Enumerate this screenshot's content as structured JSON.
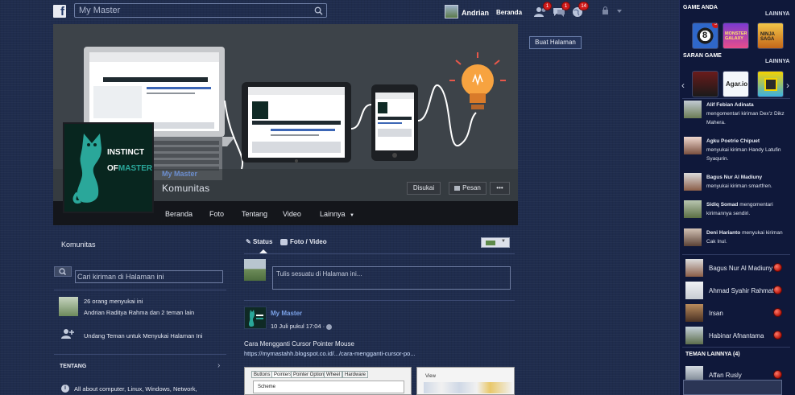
{
  "topbar": {
    "logo": "f",
    "search_placeholder": "My Master",
    "user_name": "Andrian",
    "home_label": "Beranda",
    "friend_requests_count": "1",
    "messages_count": "1",
    "notifications_count": "14"
  },
  "cover": {
    "page_name": "My Master",
    "page_category": "Komunitas",
    "liked_button": "Disukai",
    "message_button": "Pesan",
    "more_button": "•••",
    "create_page_button": "Buat Halaman",
    "logo_line1": "INSTINCT",
    "logo_line2": "OF",
    "logo_line3": "MASTER",
    "tabs": [
      "Beranda",
      "Foto",
      "Tentang",
      "Video",
      "Lainnya"
    ]
  },
  "left": {
    "title": "Komunitas",
    "search_placeholder": "Cari kiriman di Halaman ini",
    "likes_line1": "26 orang menyukai ini",
    "likes_line2": "Andrian Raditya Rahma dan 2 teman lain",
    "invite_text": "Undang Teman untuk Menyukai Halaman Ini",
    "about_title": "TENTANG",
    "about_text": "All about computer, Linux, Windows, Network,"
  },
  "composer": {
    "tab_status": "Status",
    "tab_photo": "Foto / Video",
    "placeholder": "Tulis sesuatu di Halaman ini..."
  },
  "post": {
    "author": "My Master",
    "time": "10 Juli pukul 17:04 ·",
    "text": "Cara Mengganti Cursor Pointer Mouse",
    "link": "https://mymastahh.blogspot.co.id/.../cara-mengganti-cursor-po...",
    "image_tabs": [
      "Buttons",
      "Pointers",
      "Pointer Options",
      "Wheel",
      "Hardware"
    ],
    "image_scheme": "Scheme",
    "image2_label": "View"
  },
  "sidebar": {
    "games_title": "GAME ANDA",
    "more1": "LAINNYA",
    "games": [
      {
        "name": "8 Ball Pool",
        "badge": "3"
      },
      {
        "name": "Monster Galaxy",
        "badge": ""
      },
      {
        "name": "Ninja Saga",
        "badge": ""
      }
    ],
    "suggest_title": "SARAN GAME",
    "more2": "LAINNYA",
    "suggest_games": [
      "Hero Zero",
      "Agar.io",
      "Geometry Dash"
    ],
    "ticker": [
      {
        "name": "Alif Febian Adinata",
        "text": "mengomentari kiriman Dex'z Dikz Mahera."
      },
      {
        "name": "Agku Poetrie Chipuet",
        "text": "menyukai kiriman Handy Latufin Syaqurin."
      },
      {
        "name": "Bagus Nur Al Madiuny",
        "text": "menyukai kiriman smartfren."
      },
      {
        "name": "Sidiq Somad",
        "text": "mengomentari kirimannya sendiri."
      },
      {
        "name": "Deni Harianto",
        "text": "menyukai kiriman Cak Inul."
      }
    ],
    "chat": [
      "Bagus Nur Al Madiuny",
      "Ahmad Syahir Rahmat",
      "Irsan",
      "Habinar Afnantama"
    ],
    "other_friends_title": "TEMAN LAINNYA (4)",
    "other_friends": [
      "Affan Rusly"
    ]
  }
}
